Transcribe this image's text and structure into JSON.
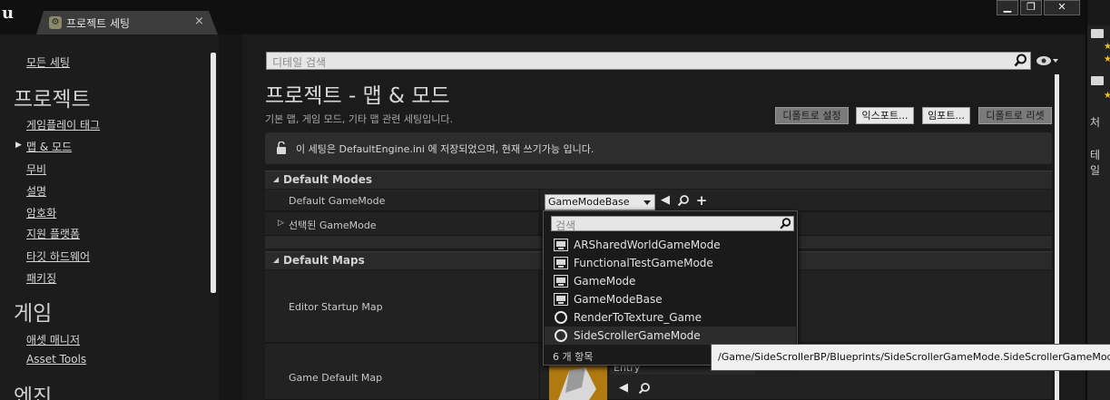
{
  "window": {
    "tab_title": "프로젝트 세팅",
    "tab_close": "×",
    "controls": [
      "▁",
      "❐",
      "✕"
    ]
  },
  "sidebar": {
    "all_settings": "모든 세팅",
    "project_header": "프로젝트",
    "project_items": [
      "게임플레이 태그",
      "맵 & 모드",
      "무비",
      "설명",
      "암호화",
      "지원 플랫폼",
      "타깃 하드웨어",
      "패키징"
    ],
    "selected_item": "맵 & 모드",
    "game_header": "게임",
    "game_items": [
      "애셋 매니저",
      "Asset Tools"
    ],
    "engine_header": "엔진"
  },
  "right_strip": {
    "text1": "처",
    "text2": "테일"
  },
  "main": {
    "search_placeholder": "디테일 검색",
    "title": "프로젝트 - 맵 & 모드",
    "description": "기본 맵, 게임 모드, 기타 맵 관련 세팅입니다.",
    "buttons": {
      "set_default": "디폴트로 설정",
      "export": "익스포트...",
      "import": "임포트...",
      "reset_default": "디폴트로 리셋"
    },
    "notice": "이 세팅은 DefaultEngine.ini 에 저장되었으며, 현재 쓰기가능 입니다.",
    "sections": {
      "default_modes": "Default Modes",
      "default_maps": "Default Maps"
    },
    "rows": {
      "default_gamemode": "Default GameMode",
      "selected_gamemode": "선택된 GameMode",
      "editor_startup_map": "Editor Startup Map",
      "game_default_map": "Game Default Map"
    },
    "gamemode_value": "GameModeBase",
    "entry_label": "Entry"
  },
  "dropdown": {
    "search_placeholder": "검색",
    "items": [
      {
        "label": "ARSharedWorldGameMode",
        "icon": "blueprint-icon"
      },
      {
        "label": "FunctionalTestGameMode",
        "icon": "blueprint-icon"
      },
      {
        "label": "GameMode",
        "icon": "blueprint-icon"
      },
      {
        "label": "GameModeBase",
        "icon": "blueprint-icon"
      },
      {
        "label": "RenderToTexture_Game",
        "icon": "circle-icon"
      },
      {
        "label": "SideScrollerGameMode",
        "icon": "circle-icon"
      }
    ],
    "hovered_item": "SideScrollerGameMode",
    "count": "6 개 항목"
  },
  "tooltip": "/Game/SideScrollerBP/Blueprints/SideScrollerGameMode.SideScrollerGameMode_C"
}
